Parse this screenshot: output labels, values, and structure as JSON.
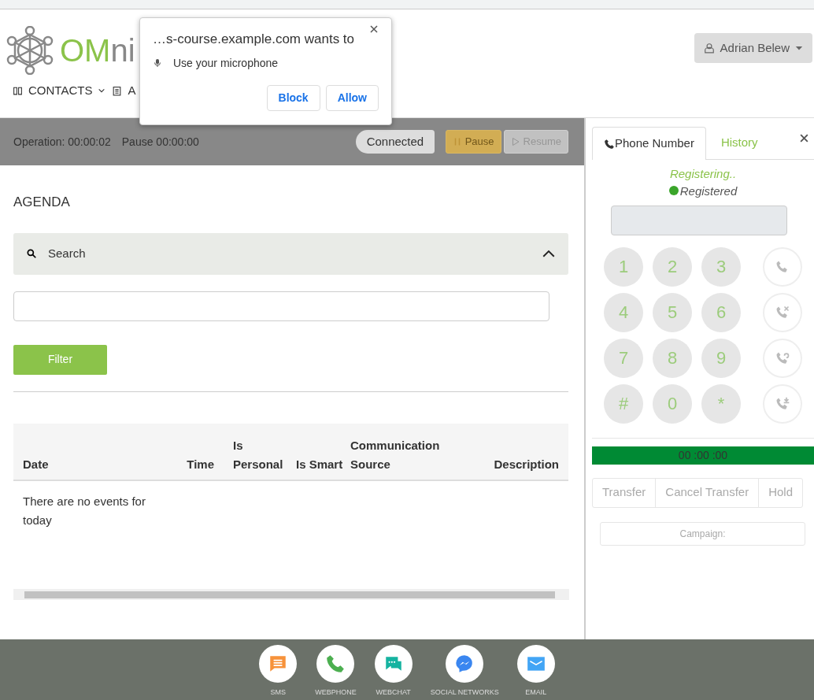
{
  "logo": {
    "text_accent": "OM",
    "text_rest": "ni"
  },
  "nav": [
    {
      "label": "CONTACTS",
      "has_dropdown": true
    },
    {
      "label": "A",
      "has_dropdown": false
    }
  ],
  "user_menu": {
    "name": "Adrian Belew"
  },
  "permission_popup": {
    "title": "…s-course.example.com wants to",
    "request": "Use your microphone",
    "buttons": [
      {
        "label": "Block"
      },
      {
        "label": "Allow"
      }
    ]
  },
  "status_bar": {
    "operation": "Operation: 00:00:02",
    "pause_time": "Pause 00:00:00",
    "connection": "Connected",
    "buttons": [
      {
        "label": "Pause",
        "kind": "pause",
        "disabled": true
      },
      {
        "label": "Resume",
        "kind": "resume",
        "disabled": true
      }
    ]
  },
  "agenda": {
    "title": "AGENDA",
    "search_panel": {
      "label": "Search",
      "expanded": true
    },
    "filter_button": "Filter",
    "table": {
      "columns": [
        "Date",
        "Time",
        "Is Personal",
        "Is Smart",
        "Communication Source",
        "Description"
      ],
      "empty_message": "There are no events for today"
    }
  },
  "phone": {
    "tabs": [
      {
        "label": "Phone Number",
        "selected": true
      },
      {
        "label": "History",
        "selected": false
      }
    ],
    "registering": "Registering..",
    "registered": "Registered",
    "keys": [
      "1",
      "2",
      "3",
      "4",
      "5",
      "6",
      "7",
      "8",
      "9",
      "#",
      "0",
      "*"
    ],
    "call_actions": [
      {
        "kind": "call"
      },
      {
        "kind": "reject"
      },
      {
        "kind": "redial"
      },
      {
        "kind": "incoming"
      }
    ],
    "timer": "00 :00 :00",
    "actions": [
      "Transfer",
      "Cancel Transfer",
      "Hold"
    ],
    "campaign": "Campaign:"
  },
  "channels": [
    {
      "label": "SMS",
      "kind": "sms"
    },
    {
      "label": "WEBPHONE",
      "kind": "phone"
    },
    {
      "label": "WEBCHAT",
      "kind": "chat"
    },
    {
      "label": "SOCIAL NETWORKS",
      "kind": "messenger"
    },
    {
      "label": "EMAIL",
      "kind": "email"
    }
  ]
}
